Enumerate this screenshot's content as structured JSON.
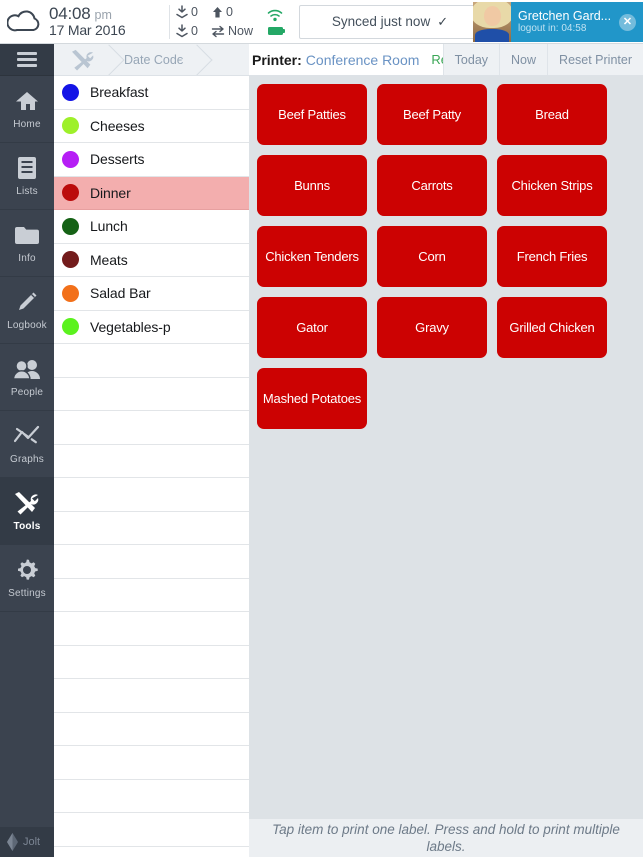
{
  "statusbar": {
    "time": "04:08",
    "ampm": "pm",
    "date": "17 Mar 2016",
    "download_count": "0",
    "upload_count": "0",
    "download_count2": "0",
    "sync_label": "Now",
    "sync_button": "Synced just now",
    "sync_check": "✓",
    "cloud_icon": "cloud-icon",
    "wifi_icon": "wifi-icon",
    "battery_icon": "battery-icon"
  },
  "user": {
    "name": "Gretchen Gard...",
    "logout": "logout in: 04:58",
    "close": "✕"
  },
  "sidebar": {
    "menu_icon": "hamburger-icon",
    "items": [
      {
        "label": "Home",
        "icon": "home-icon",
        "active": false
      },
      {
        "label": "Lists",
        "icon": "list-icon",
        "active": false
      },
      {
        "label": "Info",
        "icon": "folder-icon",
        "active": false
      },
      {
        "label": "Logbook",
        "icon": "pencil-icon",
        "active": false
      },
      {
        "label": "People",
        "icon": "people-icon",
        "active": false
      },
      {
        "label": "Graphs",
        "icon": "chart-icon",
        "active": false
      },
      {
        "label": "Tools",
        "icon": "tools-icon",
        "active": true
      },
      {
        "label": "Settings",
        "icon": "gear-icon",
        "active": false
      }
    ],
    "brand": "Jolt"
  },
  "breadcrumb": {
    "items": [
      {
        "label": "",
        "icon": "tools-icon"
      },
      {
        "label": "Date Code",
        "icon": ""
      }
    ]
  },
  "printer": {
    "label": "Printer:",
    "name": "Conference Room",
    "status": "Ready",
    "status_color": "#3aa655",
    "buttons": [
      "Today",
      "Now",
      "Reset Printer"
    ]
  },
  "categories": [
    {
      "name": "Breakfast",
      "color": "#1414e6",
      "selected": false
    },
    {
      "name": "Cheeses",
      "color": "#9ef02a",
      "selected": false
    },
    {
      "name": "Desserts",
      "color": "#b61ef5",
      "selected": false
    },
    {
      "name": "Dinner",
      "color": "#bb0c0c",
      "selected": true
    },
    {
      "name": "Lunch",
      "color": "#156215",
      "selected": false
    },
    {
      "name": "Meats",
      "color": "#731c1c",
      "selected": false
    },
    {
      "name": "Salad Bar",
      "color": "#f2701a",
      "selected": false
    },
    {
      "name": "Vegetables-p",
      "color": "#5bf21e",
      "selected": false
    }
  ],
  "empty_row_count": 15,
  "items": [
    "Beef Patties",
    "Beef Patty",
    "Bread",
    "Bunns",
    "Carrots",
    "Chicken Strips",
    "Chicken Tenders",
    "Corn",
    "French Fries",
    "Gator",
    "Gravy",
    "Grilled Chicken",
    "Mashed Potatoes"
  ],
  "hint": "Tap item to print one label. Press and hold to print multiple labels."
}
